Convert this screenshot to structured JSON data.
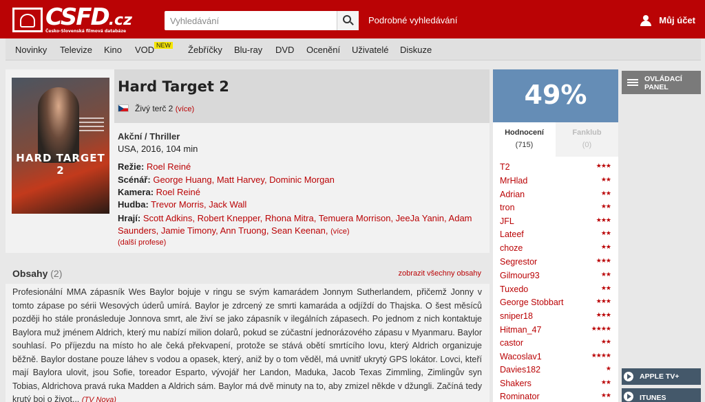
{
  "header": {
    "logo_text": "CSFD",
    "logo_suffix": ".cz",
    "logo_subtitle": "Česko-Slovenská filmová databáze",
    "search_placeholder": "Vyhledávání",
    "advanced_search": "Podrobné vyhledávání",
    "account": "Můj účet"
  },
  "nav": {
    "items": [
      "Novinky",
      "Televize",
      "Kino",
      "VOD",
      "Žebříčky",
      "Blu-ray",
      "DVD",
      "Ocenění",
      "Uživatelé",
      "Diskuze"
    ],
    "vod_badge": "NEW"
  },
  "film": {
    "title": "Hard Target 2",
    "poster_title": "HARD TARGET 2",
    "alt_title": "Živý terč 2",
    "alt_more": "(více)",
    "genre": "Akční / Thriller",
    "origin": "USA, 2016, 104 min",
    "crew": [
      {
        "role": "Režie:",
        "names": "Roel Reiné"
      },
      {
        "role": "Scénář:",
        "names": "George Huang, Matt Harvey, Dominic Morgan"
      },
      {
        "role": "Kamera:",
        "names": "Roel Reiné"
      },
      {
        "role": "Hudba:",
        "names": "Trevor Morris, Jack Wall"
      }
    ],
    "cast_role": "Hrají:",
    "cast_names": "Scott Adkins, Robert Knepper, Rhona Mitra, Temuera Morrison, JeeJa Yanin, Adam Saunders, Jamie Timony, Ann Truong, Sean Keenan,",
    "cast_more": "(více)",
    "more_professions": "(další profese)"
  },
  "plot": {
    "title": "Obsahy",
    "count": "(2)",
    "show_all": "zobrazit všechny obsahy",
    "text": "Profesionální MMA zápasník Wes Baylor bojuje v ringu se svým kamarádem Jonnym Sutherlandem, přičemž Jonny v tomto zápase po sérii Wesových úderů umírá. Baylor je zdrcený ze smrti kamaráda a odjíždí do Thajska. O šest měsíců později ho stále pronásleduje Jonnova smrt, ale živí se jako zápasník v ilegálních zápasech. Po jednom z nich kontaktuje Baylora muž jménem Aldrich, který mu nabízí milion dolarů, pokud se zúčastní jednorázového zápasu v Myanmaru. Baylor souhlasí. Po příjezdu na místo ho ale čeká překvapení, protože se stává obětí smrtícího lovu, který Aldrich organizuje běžně. Baylor dostane pouze láhev s vodou a opasek, který, aniž by o tom věděl, má uvnitř ukrytý GPS lokátor. Lovci, kteří mají Baylora ulovit, jsou Sofie, toreador Esparto, vývojář her Landon, Maduka, Jacob Texas Zimmling, Zimlingův syn Tobias, Aldrichova pravá ruka Madden a Aldrich sám. Baylor má dvě minuty na to, aby zmizel někde v džungli. Začíná tedy krutý boj o život...",
    "source": "(TV Nova)"
  },
  "rating": {
    "value": "49%",
    "tab_ratings": "Hodnocení",
    "tab_ratings_count": "(715)",
    "tab_fanclub": "Fanklub",
    "tab_fanclub_count": "(0)",
    "users": [
      {
        "name": "T2",
        "stars": "★★★",
        "score": 3
      },
      {
        "name": "MrHlad",
        "stars": "★★",
        "score": 2
      },
      {
        "name": "Adrian",
        "stars": "★★",
        "score": 2
      },
      {
        "name": "tron",
        "stars": "★★",
        "score": 2
      },
      {
        "name": "JFL",
        "stars": "★★★",
        "score": 3
      },
      {
        "name": "Lateef",
        "stars": "★★",
        "score": 2
      },
      {
        "name": "choze",
        "stars": "★★",
        "score": 2
      },
      {
        "name": "Segrestor",
        "stars": "★★★",
        "score": 3
      },
      {
        "name": "Gilmour93",
        "stars": "★★",
        "score": 2
      },
      {
        "name": "Tuxedo",
        "stars": "★★",
        "score": 2
      },
      {
        "name": "George Stobbart",
        "stars": "★★★",
        "score": 3
      },
      {
        "name": "sniper18",
        "stars": "★★★",
        "score": 3
      },
      {
        "name": "Hitman_47",
        "stars": "★★★★",
        "score": 4
      },
      {
        "name": "castor",
        "stars": "★★",
        "score": 2
      },
      {
        "name": "Wacoslav1",
        "stars": "★★★★",
        "score": 4
      },
      {
        "name": "Davies182",
        "stars": "★",
        "score": 1
      },
      {
        "name": "Shakers",
        "stars": "★★",
        "score": 2
      },
      {
        "name": "Rominator",
        "stars": "★★",
        "score": 2
      }
    ]
  },
  "side_panel": {
    "control_panel": "OVLÁDACÍ PANEL",
    "vod_buttons": [
      "APPLE TV+",
      "ITUNES"
    ]
  },
  "colors": {
    "brand_red": "#ba0305",
    "rating_blue": "#658db6",
    "panel_gray": "#7a7a7a",
    "vod_slate": "#44586a"
  }
}
